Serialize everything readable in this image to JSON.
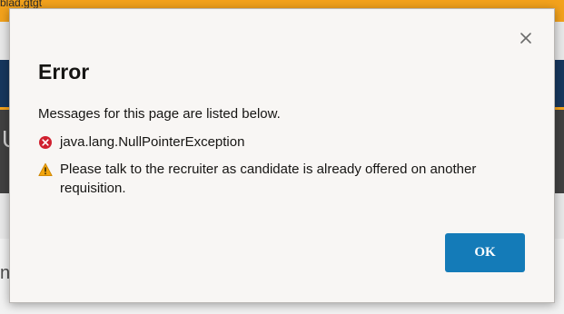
{
  "background": {
    "topbar_text": "blad.gtgt",
    "band_letter": "U",
    "lower_letter": "n"
  },
  "dialog": {
    "title": "Error",
    "intro": "Messages for this page are listed below.",
    "messages": [
      {
        "type": "error",
        "icon": "error-circle-icon",
        "text": "java.lang.NullPointerException"
      },
      {
        "type": "warning",
        "icon": "warning-triangle-icon",
        "text": "Please talk to the recruiter as candidate is already offered on another requisition."
      }
    ],
    "ok_label": "OK",
    "close_icon": "close-icon"
  },
  "colors": {
    "accent": "#147bb8",
    "error": "#d0202f",
    "warning": "#f2a50c",
    "topbar": "#f3a21c",
    "nav": "#17375e"
  }
}
